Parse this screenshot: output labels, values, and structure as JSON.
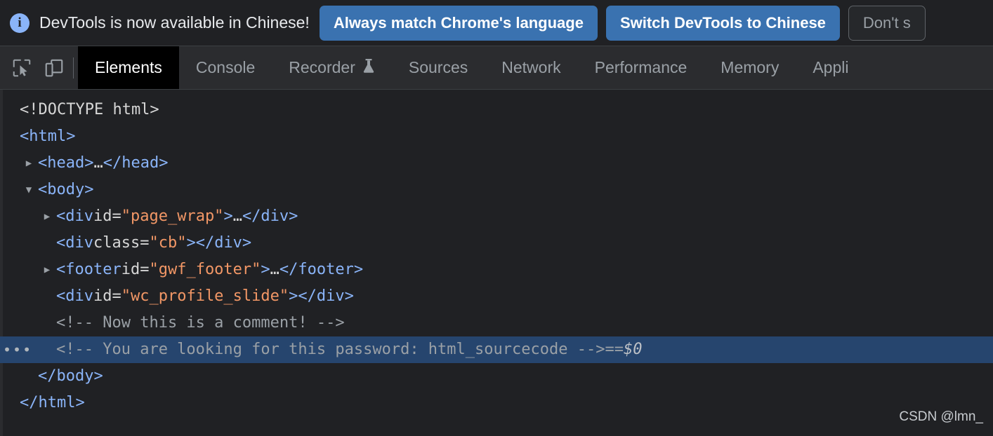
{
  "banner": {
    "icon": "info-icon",
    "message": "DevTools is now available in Chinese!",
    "buttons": [
      {
        "label": "Always match Chrome's language",
        "style": "primary"
      },
      {
        "label": "Switch DevTools to Chinese",
        "style": "primary"
      },
      {
        "label": "Don't s",
        "style": "secondary"
      }
    ]
  },
  "toolbar": {
    "icons": [
      {
        "name": "inspect-element-icon"
      },
      {
        "name": "device-toolbar-icon"
      }
    ],
    "tabs": [
      {
        "label": "Elements",
        "active": true,
        "experimental": false
      },
      {
        "label": "Console",
        "active": false,
        "experimental": false
      },
      {
        "label": "Recorder",
        "active": false,
        "experimental": true
      },
      {
        "label": "Sources",
        "active": false,
        "experimental": false
      },
      {
        "label": "Network",
        "active": false,
        "experimental": false
      },
      {
        "label": "Performance",
        "active": false,
        "experimental": false
      },
      {
        "label": "Memory",
        "active": false,
        "experimental": false
      },
      {
        "label": "Appli",
        "active": false,
        "experimental": false
      }
    ]
  },
  "dom_tree": {
    "rows": [
      {
        "indent": 0,
        "twisty": "none",
        "selected": false,
        "dots": false,
        "parts": [
          {
            "text": "<!DOCTYPE html>",
            "cls": "t-doctype"
          }
        ]
      },
      {
        "indent": 0,
        "twisty": "none",
        "selected": false,
        "dots": false,
        "parts": [
          {
            "text": "<html>",
            "cls": "t-tag"
          }
        ]
      },
      {
        "indent": 1,
        "twisty": "collapsed",
        "selected": false,
        "dots": false,
        "parts": [
          {
            "text": "<head>",
            "cls": "t-tag"
          },
          {
            "text": "…",
            "cls": "t-plain"
          },
          {
            "text": "</head>",
            "cls": "t-tag"
          }
        ]
      },
      {
        "indent": 1,
        "twisty": "expanded",
        "selected": false,
        "dots": false,
        "parts": [
          {
            "text": "<body>",
            "cls": "t-tag"
          }
        ]
      },
      {
        "indent": 2,
        "twisty": "collapsed",
        "selected": false,
        "dots": false,
        "parts": [
          {
            "text": "<div ",
            "cls": "t-tag"
          },
          {
            "text": "id",
            "cls": "t-attr"
          },
          {
            "text": "=",
            "cls": "t-attr"
          },
          {
            "text": "\"page_wrap\"",
            "cls": "t-value"
          },
          {
            "text": ">",
            "cls": "t-tag"
          },
          {
            "text": "…",
            "cls": "t-plain"
          },
          {
            "text": "</div>",
            "cls": "t-tag"
          }
        ]
      },
      {
        "indent": 2,
        "twisty": "none",
        "selected": false,
        "dots": false,
        "parts": [
          {
            "text": "<div ",
            "cls": "t-tag"
          },
          {
            "text": "class",
            "cls": "t-attr"
          },
          {
            "text": "=",
            "cls": "t-attr"
          },
          {
            "text": "\"cb\"",
            "cls": "t-value"
          },
          {
            "text": ">",
            "cls": "t-tag"
          },
          {
            "text": "</div>",
            "cls": "t-tag"
          }
        ]
      },
      {
        "indent": 2,
        "twisty": "collapsed",
        "selected": false,
        "dots": false,
        "parts": [
          {
            "text": "<footer ",
            "cls": "t-tag"
          },
          {
            "text": "id",
            "cls": "t-attr"
          },
          {
            "text": "=",
            "cls": "t-attr"
          },
          {
            "text": "\"gwf_footer\"",
            "cls": "t-value"
          },
          {
            "text": ">",
            "cls": "t-tag"
          },
          {
            "text": "…",
            "cls": "t-plain"
          },
          {
            "text": "</footer>",
            "cls": "t-tag"
          }
        ]
      },
      {
        "indent": 2,
        "twisty": "none",
        "selected": false,
        "dots": false,
        "parts": [
          {
            "text": "<div ",
            "cls": "t-tag"
          },
          {
            "text": "id",
            "cls": "t-attr"
          },
          {
            "text": "=",
            "cls": "t-attr"
          },
          {
            "text": "\"wc_profile_slide\"",
            "cls": "t-value"
          },
          {
            "text": ">",
            "cls": "t-tag"
          },
          {
            "text": "</div>",
            "cls": "t-tag"
          }
        ]
      },
      {
        "indent": 2,
        "twisty": "none",
        "selected": false,
        "dots": false,
        "parts": [
          {
            "text": "<!-- Now this is a comment! -->",
            "cls": "t-comment"
          }
        ]
      },
      {
        "indent": 2,
        "twisty": "none",
        "selected": true,
        "dots": true,
        "parts": [
          {
            "text": "<!-- You are looking for this password: html_sourcecode -->",
            "cls": "t-comment"
          },
          {
            "text": " == ",
            "cls": "t-eq"
          },
          {
            "text": "$0",
            "cls": "t-dollar"
          }
        ]
      },
      {
        "indent": 1,
        "twisty": "none",
        "selected": false,
        "dots": false,
        "parts": [
          {
            "text": "</body>",
            "cls": "t-tag"
          }
        ]
      },
      {
        "indent": 0,
        "twisty": "none",
        "selected": false,
        "dots": false,
        "parts": [
          {
            "text": "</html>",
            "cls": "t-tag"
          }
        ]
      }
    ]
  },
  "watermark": {
    "text": "CSDN @lmn_"
  },
  "colors": {
    "background": "#202124",
    "tabbar": "#2b2c2f",
    "accent_blue": "#8ab4f8",
    "button_blue": "#3a72b0",
    "selection_blue": "#26456e",
    "tag_blue": "#8ab4f8",
    "attr_value_orange": "#f29766",
    "comment_gray": "#9aa0a6"
  }
}
